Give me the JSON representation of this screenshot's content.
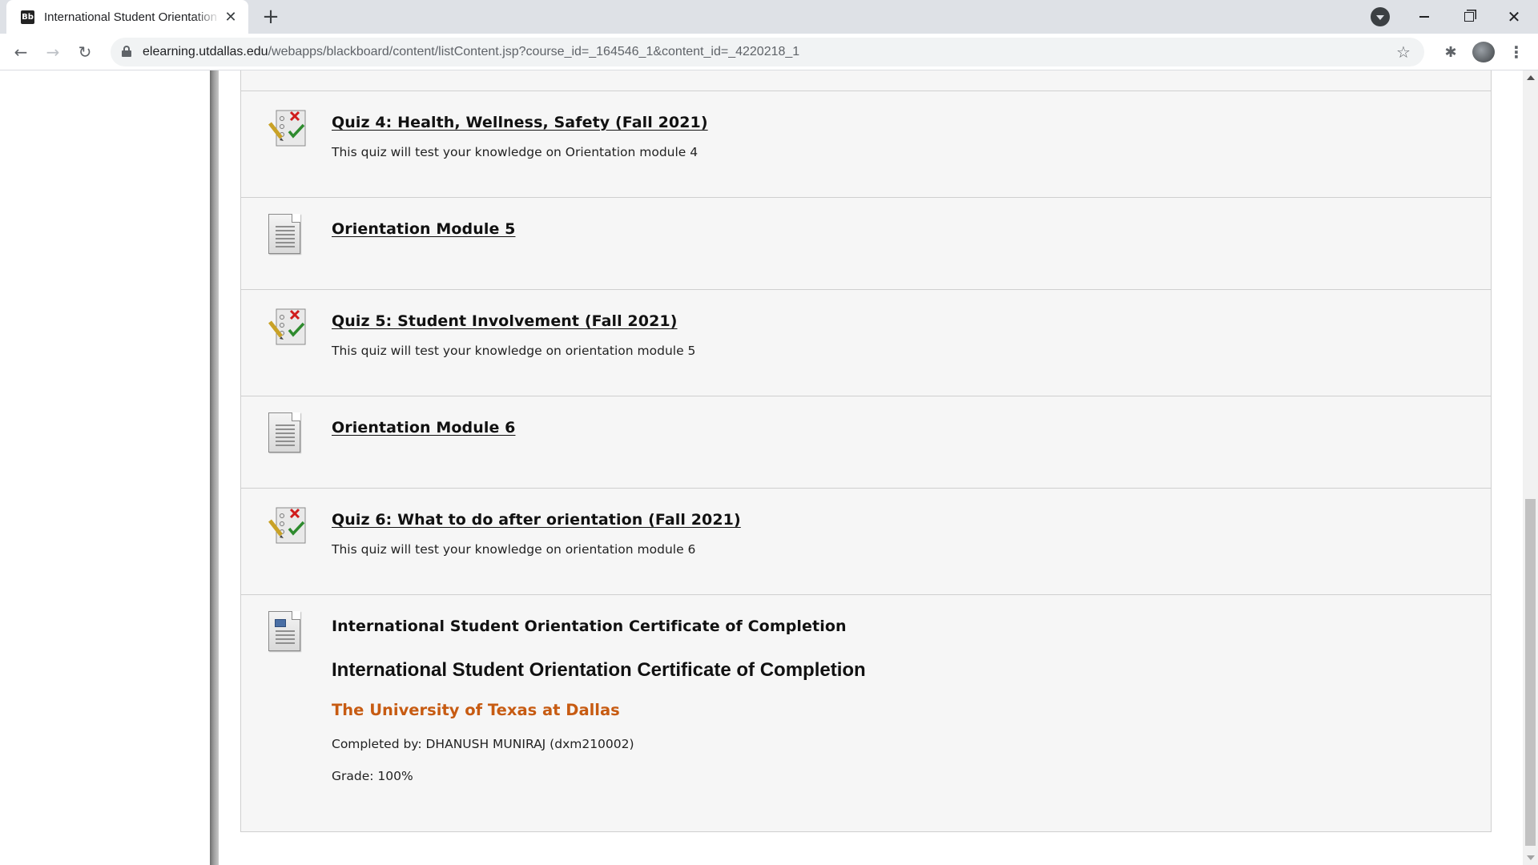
{
  "browser": {
    "tab_title": "International Student Orientation",
    "tab_favicon_text": "Bb",
    "new_tab": "+",
    "url_host": "elearning.utdallas.edu",
    "url_path": "/webapps/blackboard/content/listContent.jsp?course_id=_164546_1&content_id=_4220218_1",
    "icons": [
      "back-icon",
      "forward-icon",
      "reload-icon",
      "lock-icon",
      "star-icon",
      "extensions-icon",
      "profile-avatar",
      "kebab-menu-icon",
      "tab-search-icon"
    ]
  },
  "content": {
    "items": [
      {
        "type": "quiz",
        "icon": "quiz-icon",
        "title": "Quiz 4: Health, Wellness, Safety (Fall 2021)",
        "description": "This quiz will test your knowledge on Orientation module 4"
      },
      {
        "type": "document",
        "icon": "document-icon",
        "title": "Orientation Module 5"
      },
      {
        "type": "quiz",
        "icon": "quiz-icon",
        "title": "Quiz 5: Student Involvement (Fall 2021)",
        "description": "This quiz will test your knowledge on orientation module 5"
      },
      {
        "type": "document",
        "icon": "document-icon",
        "title": "Orientation Module 6"
      },
      {
        "type": "quiz",
        "icon": "quiz-icon",
        "title": "Quiz 6: What to do after orientation (Fall 2021)",
        "description": "This quiz will test your knowledge on orientation module 6"
      }
    ],
    "certificate": {
      "icon": "certificate-document-icon",
      "title": "International Student Orientation Certificate of Completion",
      "heading": "International Student Orientation Certificate of Completion",
      "organization": "The University of Texas at Dallas",
      "completed_by": "Completed by: DHANUSH MUNIRAJ (dxm210002)",
      "grade": "Grade: 100%"
    }
  },
  "colors": {
    "utd_orange": "#c75b12",
    "item_background": "#f6f6f6",
    "border": "#cfcfcf"
  }
}
